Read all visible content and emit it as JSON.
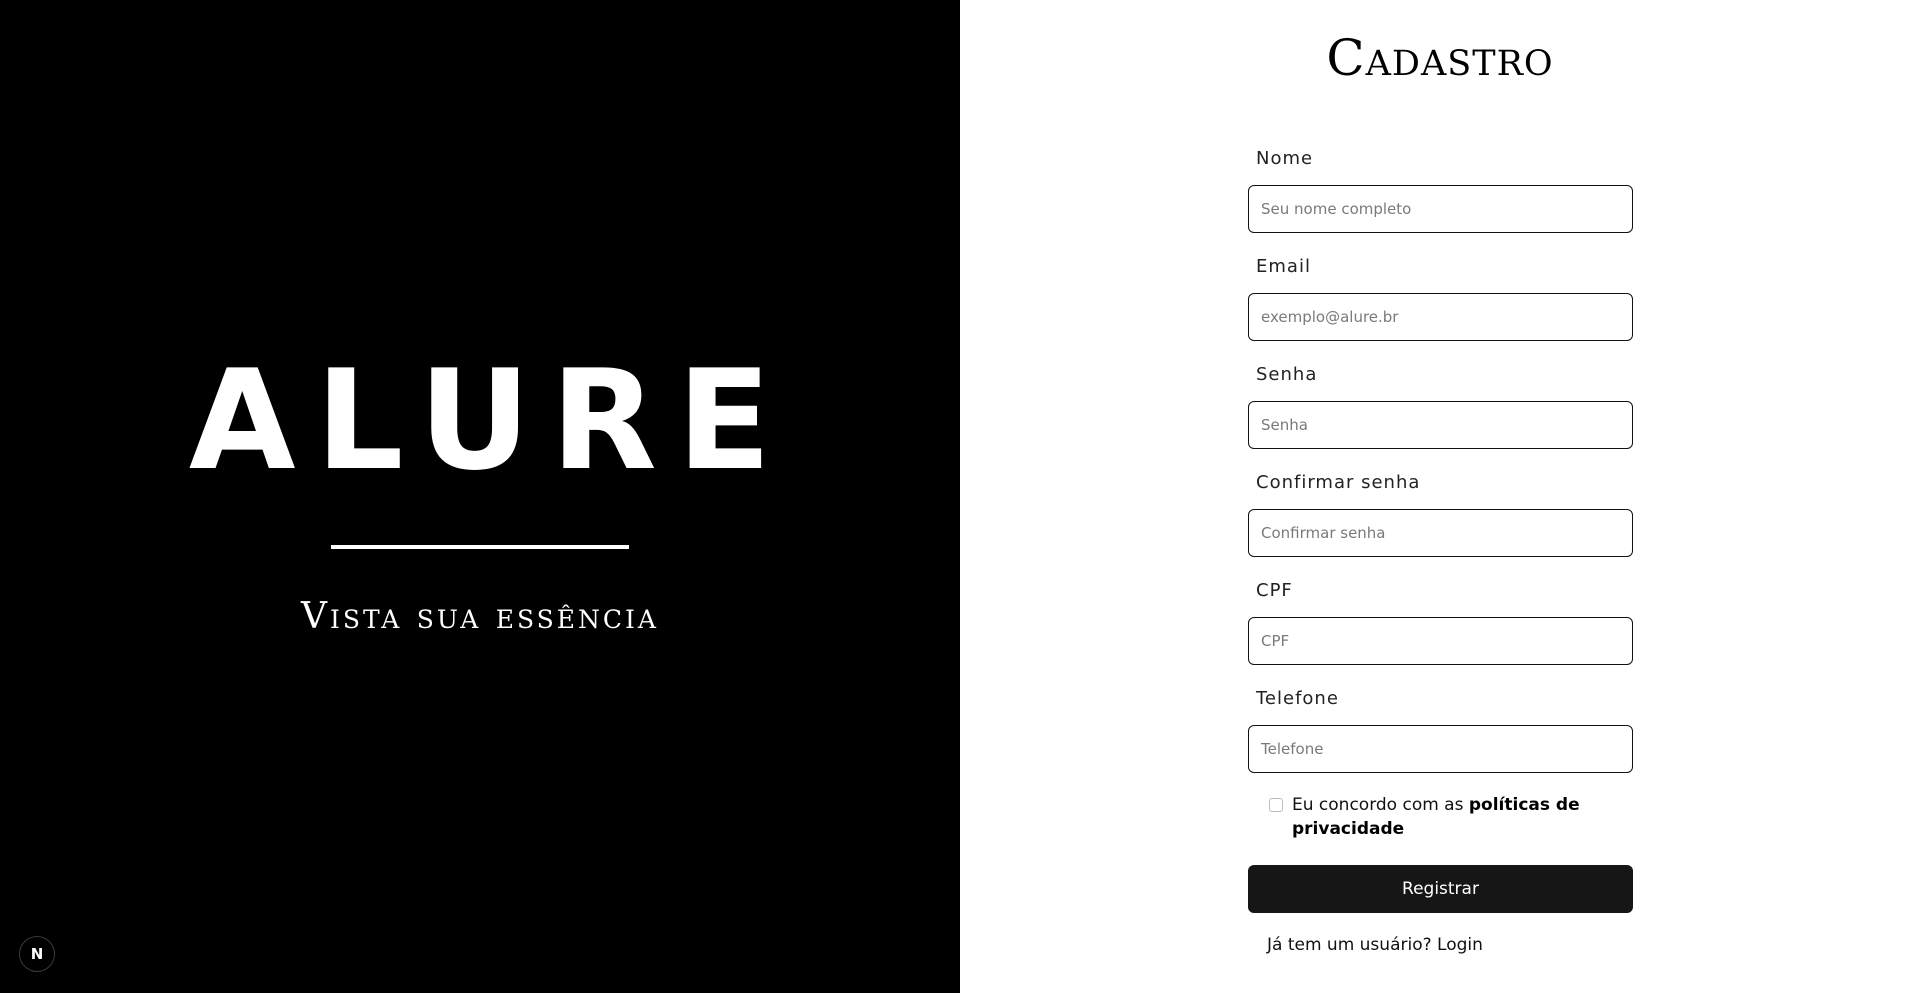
{
  "brand": {
    "name": "ALURE",
    "tagline": "Vista sua essência"
  },
  "dev_badge": {
    "label": "N",
    "icon": "nextjs-logo-icon"
  },
  "form": {
    "title": "Cadastro",
    "fields": [
      {
        "label": "Nome",
        "placeholder": "Seu nome completo",
        "value": ""
      },
      {
        "label": "Email",
        "placeholder": "exemplo@alure.br",
        "value": ""
      },
      {
        "label": "Senha",
        "placeholder": "Senha",
        "value": ""
      },
      {
        "label": "Confirmar senha",
        "placeholder": "Confirmar senha",
        "value": ""
      },
      {
        "label": "CPF",
        "placeholder": "CPF",
        "value": ""
      },
      {
        "label": "Telefone",
        "placeholder": "Telefone",
        "value": ""
      }
    ],
    "terms": {
      "prefix": "Eu concordo com as ",
      "link": "políticas de privacidade",
      "checked": false
    },
    "submit_label": "Registrar",
    "login_prompt": "Já tem um usuário?",
    "login_link": "Login"
  },
  "colors": {
    "brand_bg": "#000000",
    "form_bg": "#ffffff",
    "button_bg": "#161616",
    "text": "#111111"
  }
}
